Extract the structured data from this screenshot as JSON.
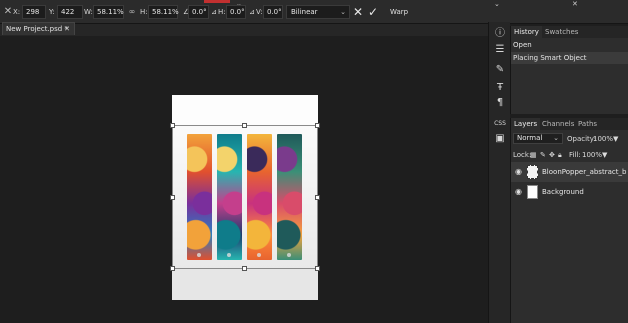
{
  "options_bar": {
    "x_label": "X:",
    "x_value": "298 px",
    "y_label": "Y:",
    "y_value": "422 px",
    "w_label": "W:",
    "w_value": "58.11%",
    "h_label": "H:",
    "h_value": "58.11%",
    "rotate_label": "∠",
    "rotate_value": "0.0°",
    "skew_h_label": "H:",
    "skew_h_value": "0.0°",
    "skew_v_label": "V:",
    "skew_v_value": "0.0°",
    "interpolation": "Bilinear",
    "warp_label": "Warp",
    "accent": "#c23030"
  },
  "document": {
    "tab_label": "New Project.psd *",
    "close_glyph": "✕"
  },
  "history_panel": {
    "tabs": [
      "History",
      "Swatches"
    ],
    "items": [
      "Open",
      "Placing Smart Object"
    ]
  },
  "layers_panel": {
    "tabs": [
      "Layers",
      "Channels",
      "Paths"
    ],
    "blend_mode": "Normal",
    "opacity_label": "Opacity:",
    "opacity_value": "100%",
    "lock_label": "Lock:",
    "fill_label": "Fill:",
    "fill_value": "100%",
    "layers": [
      {
        "name": "BloonPopper_abstract_b",
        "type": "smart-object",
        "selected": true
      },
      {
        "name": "Background",
        "type": "raster",
        "selected": false
      }
    ]
  },
  "tools": [
    "info-icon",
    "adjust-icon",
    "brush-icon",
    "type-icon",
    "paragraph-icon",
    "css-icon",
    "image-icon"
  ],
  "art_strips": [
    {
      "colors": [
        "#f2a23a",
        "#e1502e",
        "#7a2f9c",
        "#2a7fbf",
        "#f4c45a"
      ]
    },
    {
      "colors": [
        "#0f7c8a",
        "#27b5b0",
        "#c43f8c",
        "#1c3b6e",
        "#f3d36b"
      ]
    },
    {
      "colors": [
        "#f3b53b",
        "#e8642f",
        "#c8327e",
        "#ff8a3a",
        "#3a2a5a"
      ]
    },
    {
      "colors": [
        "#1f5a5a",
        "#3b8f77",
        "#d94c6a",
        "#f4a23c",
        "#7a3b8c"
      ]
    }
  ]
}
